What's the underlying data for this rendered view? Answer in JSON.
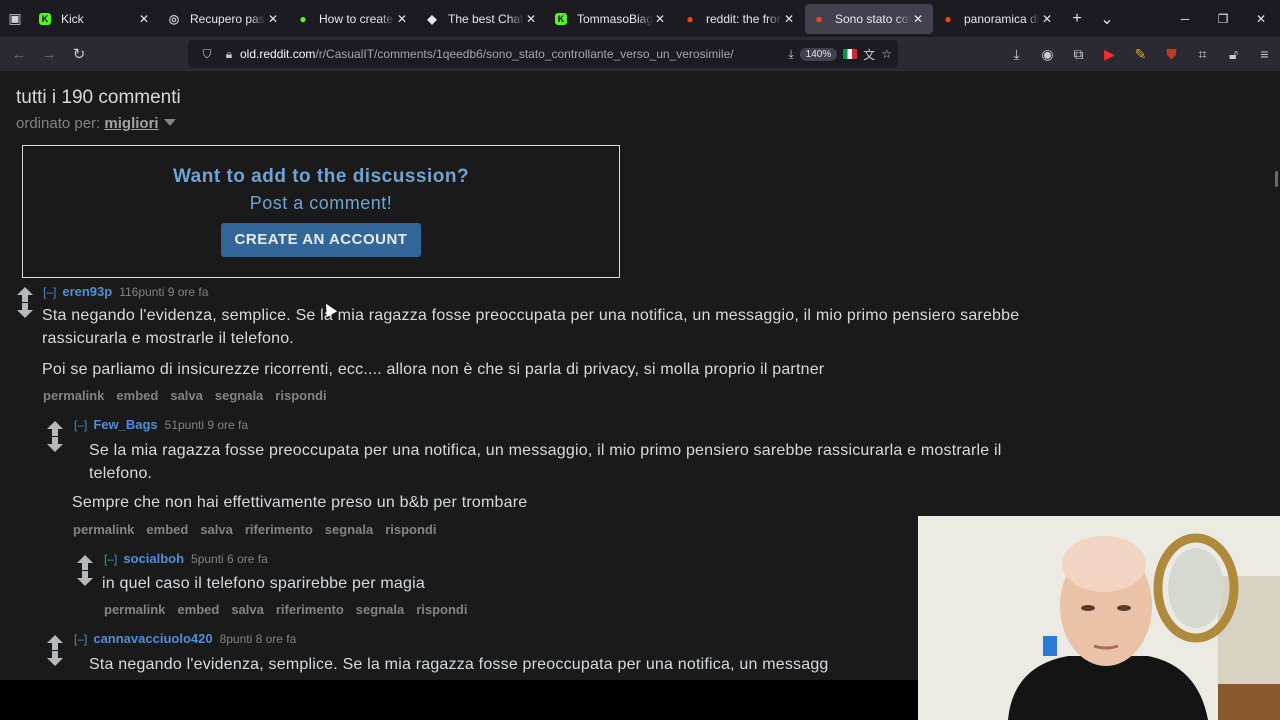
{
  "browser": {
    "tabs": [
      {
        "title": "Kick",
        "color": "#53fc18",
        "glyph": "K",
        "active": false
      },
      {
        "title": "Recupero passwo",
        "color": "#c9c9cf",
        "glyph": "◎",
        "active": false
      },
      {
        "title": "How to create a K",
        "color": "#53fc18",
        "glyph": "●",
        "active": false
      },
      {
        "title": "The best ChatBot",
        "color": "#e6e6ea",
        "glyph": "◆",
        "active": false
      },
      {
        "title": "TommasoBiagi Str",
        "color": "#53fc18",
        "glyph": "K",
        "active": false
      },
      {
        "title": "reddit: the front p",
        "color": "#ff4500",
        "glyph": "●",
        "active": false
      },
      {
        "title": "Sono stato contro",
        "color": "#ff4500",
        "glyph": "●",
        "active": true
      },
      {
        "title": "panoramica di Fin",
        "color": "#ff4500",
        "glyph": "●",
        "active": false
      }
    ],
    "url_host": "old.reddit.com",
    "url_path": "/r/CasualIT/comments/1qeedb6/sono_stato_controllante_verso_un_verosimile/",
    "zoom": "140%"
  },
  "page": {
    "title": "tutti i 190 commenti",
    "sort_label": "ordinato per:",
    "sort_value": "migliori",
    "cta": {
      "heading": "Want to add to the discussion?",
      "subheading": "Post a comment!",
      "button": "CREATE AN ACCOUNT"
    }
  },
  "comments": [
    {
      "toggle": "[–]",
      "author": "eren93p",
      "meta": "116punti 9 ore fa",
      "p1": "Sta negando l'evidenza, semplice. Se la mia ragazza fosse preoccupata per una notifica, un messaggio, il mio primo pensiero sarebbe rassicurarla e mostrarle il telefono.",
      "p2": "Poi se parliamo di insicurezze ricorrenti, ecc.... allora non è che si parla di privacy, si molla proprio il partner",
      "actions": [
        "permalink",
        "embed",
        "salva",
        "segnala",
        "rispondi"
      ]
    },
    {
      "toggle": "[–]",
      "author": "Few_Bags",
      "meta": "51punti 9 ore fa",
      "p1": "Se la mia ragazza fosse preoccupata per una notifica, un messaggio, il mio primo pensiero sarebbe rassicurarla e mostrarle il telefono.",
      "p2": "Sempre che non hai effettivamente preso un b&b per trombare",
      "actions": [
        "permalink",
        "embed",
        "salva",
        "riferimento",
        "segnala",
        "rispondi"
      ]
    },
    {
      "toggle": "[–]",
      "author": "socialboh",
      "meta": "5punti 6 ore fa",
      "p1": "in quel caso il telefono sparirebbe per magia",
      "actions": [
        "permalink",
        "embed",
        "salva",
        "riferimento",
        "segnala",
        "rispondi"
      ]
    },
    {
      "toggle": "[–]",
      "author": "cannavacciuolo420",
      "meta": "8punti 8 ore fa",
      "p1": "Sta negando l'evidenza, semplice. Se la mia ragazza fosse preoccupata per una notifica, un messagg"
    }
  ]
}
